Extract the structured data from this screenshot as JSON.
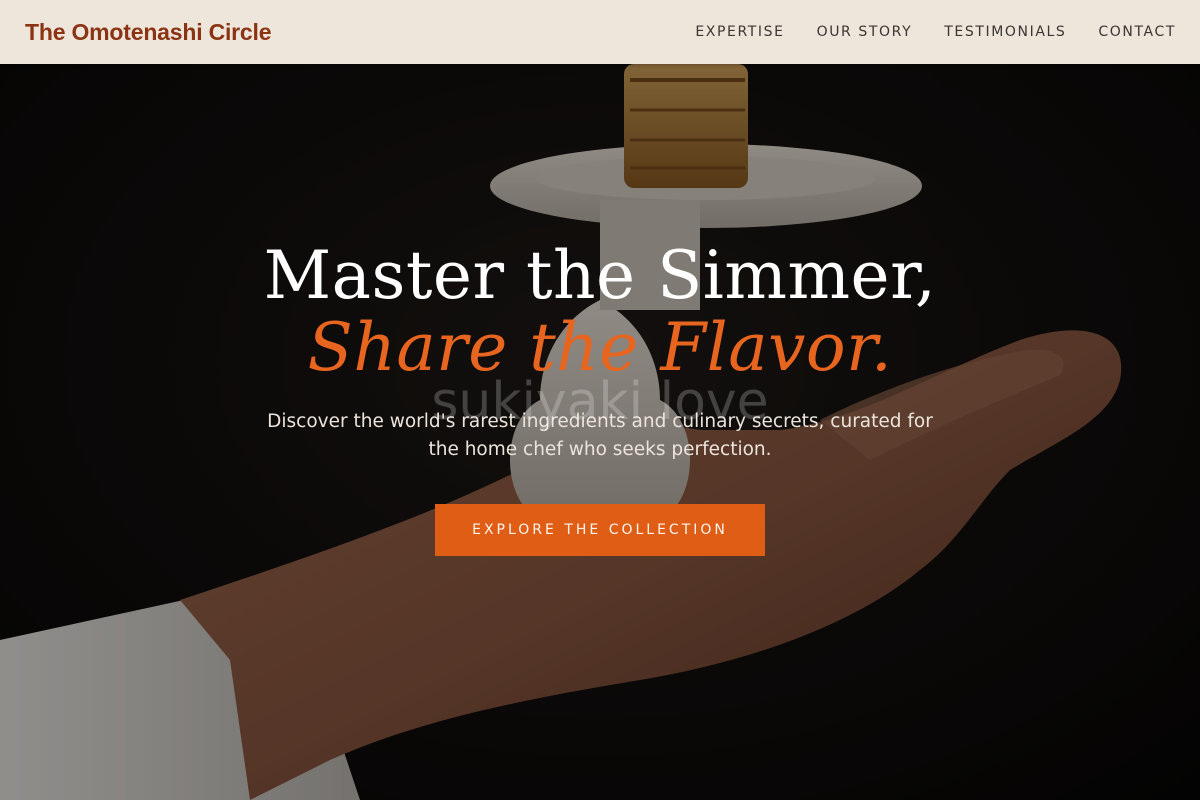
{
  "header": {
    "brand": "The Omotenashi Circle",
    "nav": [
      {
        "label": "EXPERTISE"
      },
      {
        "label": "OUR STORY"
      },
      {
        "label": "TESTIMONIALS"
      },
      {
        "label": "CONTACT"
      }
    ]
  },
  "hero": {
    "headline_line1": "Master the Simmer,",
    "headline_line2": "Share the Flavor.",
    "watermark": "sukiyaki love",
    "subtitle": "Discover the world's rarest ingredients and culinary secrets, curated for the home chef who seeks perfection.",
    "cta_label": "EXPLORE THE COLLECTION"
  },
  "colors": {
    "brand": "#8a3414",
    "accent": "#e05d16",
    "header_bg": "#f8eee4"
  }
}
